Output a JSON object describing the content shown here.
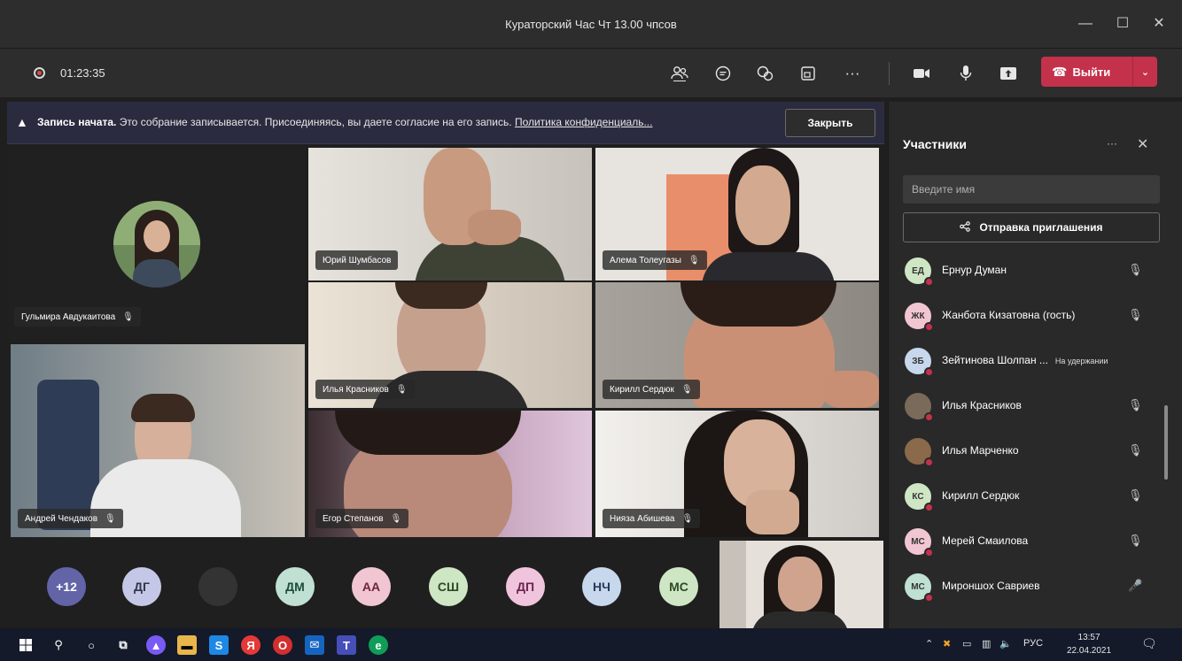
{
  "window": {
    "title": "Кураторский Час Чт 13.00 чпсов",
    "minimize": "—",
    "maximize": "☐",
    "close": "✕"
  },
  "toolbar": {
    "timer": "01:23:35",
    "more": "···",
    "leave_label": "Выйти",
    "leave_caret": "⌄"
  },
  "banner": {
    "warning_icon": "▲",
    "bold": "Запись начата.",
    "text": " Это собрание записывается. Присоединяясь, вы даете согласие на его запись. ",
    "link": "Политика конфиденциаль...",
    "close_label": "Закрыть"
  },
  "tiles": [
    {
      "name": "Гульмира Авдукаитова"
    },
    {
      "name": "Юрий Шумбасов"
    },
    {
      "name": "Алема Толеугазы"
    },
    {
      "name": "Илья Красников"
    },
    {
      "name": "Кирилл Сердюк"
    },
    {
      "name": "Андрей Чендаков"
    },
    {
      "name": "Егор Степанов"
    },
    {
      "name": "Нияза Абишева"
    }
  ],
  "avatars": [
    {
      "label": "+12",
      "bg": "#6264a7",
      "fg": "#ffffff"
    },
    {
      "label": "ДГ",
      "bg": "#c5c7e6",
      "fg": "#33344a"
    },
    {
      "label": "",
      "bg": "#333333",
      "fg": "#ffffff"
    },
    {
      "label": "ДМ",
      "bg": "#bfe0d3",
      "fg": "#1e4d3a"
    },
    {
      "label": "АА",
      "bg": "#f1c6d2",
      "fg": "#6b2737"
    },
    {
      "label": "СШ",
      "bg": "#cfe6c5",
      "fg": "#2d4a23"
    },
    {
      "label": "ДП",
      "bg": "#f0c4dc",
      "fg": "#6b2450"
    },
    {
      "label": "НЧ",
      "bg": "#c7d7ec",
      "fg": "#253b5a"
    },
    {
      "label": "МС",
      "bg": "#cfe6c5",
      "fg": "#2d4a23"
    }
  ],
  "panel": {
    "title": "Участники",
    "more": "···",
    "close": "✕",
    "search_placeholder": "Введите имя",
    "invite_label": "Отправка приглашения",
    "participants": [
      {
        "initials": "ЕД",
        "name": "Ернур Думан",
        "extra": "",
        "color": "#cfe6c5"
      },
      {
        "initials": "ЖК",
        "name": "Жанбота Кизатовна (гость)",
        "extra": "",
        "color": "#f1c6d2"
      },
      {
        "initials": "ЗБ",
        "name": "Зейтинова Шолпан ...",
        "extra": "На удержании",
        "color": "#c7d7ec"
      },
      {
        "initials": "",
        "name": "Илья Красников",
        "extra": "",
        "color": "#7a6a5a"
      },
      {
        "initials": "",
        "name": "Илья Марченко",
        "extra": "",
        "color": "#8a6a4a"
      },
      {
        "initials": "КС",
        "name": "Кирилл Сердюк",
        "extra": "",
        "color": "#cfe6c5"
      },
      {
        "initials": "МС",
        "name": "Мерей Смаилова",
        "extra": "",
        "color": "#f1c6d2"
      },
      {
        "initials": "МС",
        "name": "Мироншох Савриев",
        "extra": "",
        "color": "#bfe0d3"
      }
    ]
  },
  "taskbar": {
    "lang": "РУС",
    "time": "13:57",
    "date": "22.04.2021"
  }
}
